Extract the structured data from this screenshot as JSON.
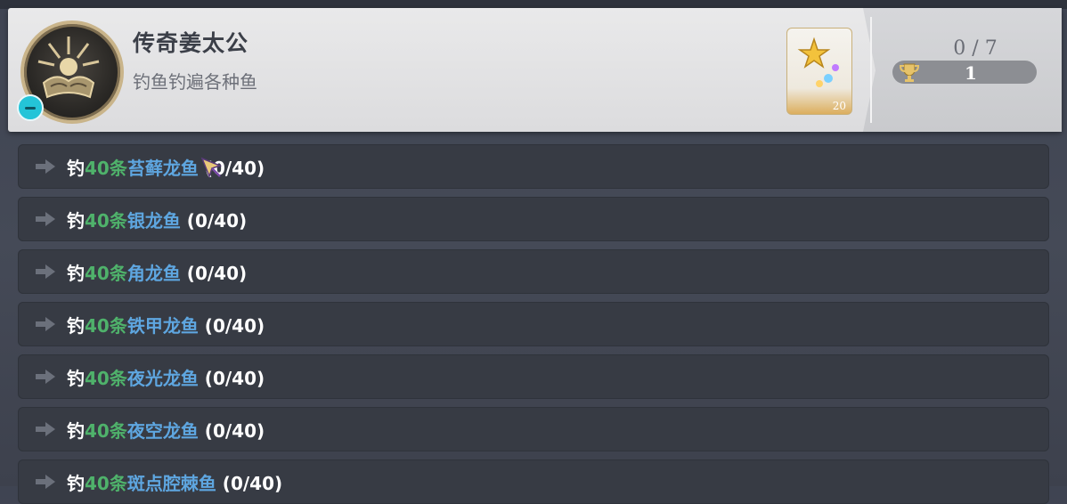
{
  "achievement": {
    "title": "传奇姜太公",
    "description": "钓鱼钓遍各种鱼",
    "reward_count": "20",
    "progress": "0 / 7",
    "trophy_count": "1"
  },
  "tasks": [
    {
      "prefix": "钓",
      "count": "40条",
      "fish": "苔藓龙鱼",
      "progress": " (0/40)"
    },
    {
      "prefix": "钓",
      "count": "40条",
      "fish": "银龙鱼",
      "progress": " (0/40)"
    },
    {
      "prefix": "钓",
      "count": "40条",
      "fish": "角龙鱼",
      "progress": " (0/40)"
    },
    {
      "prefix": "钓",
      "count": "40条",
      "fish": "铁甲龙鱼",
      "progress": " (0/40)"
    },
    {
      "prefix": "钓",
      "count": "40条",
      "fish": "夜光龙鱼",
      "progress": " (0/40)"
    },
    {
      "prefix": "钓",
      "count": "40条",
      "fish": "夜空龙鱼",
      "progress": " (0/40)"
    },
    {
      "prefix": "钓",
      "count": "40条",
      "fish": "斑点腔棘鱼",
      "progress": " (0/40)"
    }
  ],
  "colors": {
    "count_green": "#4fb26b",
    "fish_blue": "#5ea6e0",
    "row_bg": "#373b44",
    "header_bg": "#e3e3e5"
  },
  "icons": {
    "badge": "achievement-badge-icon",
    "collapse": "minus-icon",
    "reward": "star-moon-gem-icon",
    "trophy": "trophy-icon",
    "row_arrow": "arrow-right-icon",
    "pointer": "mouse-pointer-icon"
  }
}
